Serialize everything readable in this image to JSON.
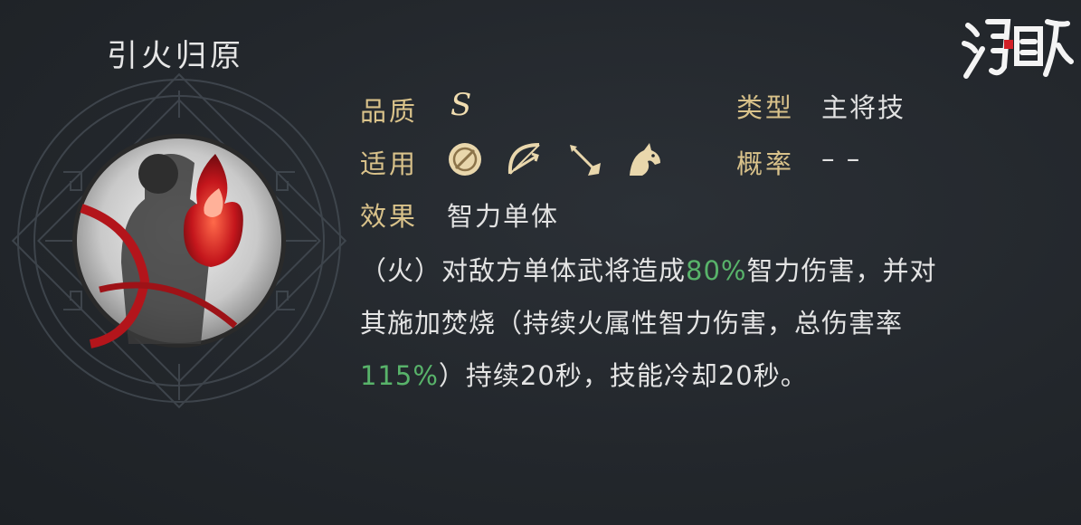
{
  "skill": {
    "name": "引火归原",
    "quality_label": "品质",
    "quality_value": "S",
    "type_label": "类型",
    "type_value": "主将技",
    "apply_label": "适用",
    "apply_icons": [
      "shield-icon",
      "bow-icon",
      "spear-icon",
      "horse-icon"
    ],
    "rate_label": "概率",
    "rate_value": "– –",
    "effect_label": "效果",
    "effect_value": "智力单体",
    "description": {
      "line1_a": "（火）对敌方单体武将造成",
      "line1_hl": "80%",
      "line1_b": "智力伤害，并对",
      "line2": "其施加焚烧（持续火属性智力伤害，总伤害率",
      "line3_hl": "115%",
      "line3_b": "）持续20秒，技能冷却20秒。"
    }
  },
  "logo": {
    "text": "鸿图之下"
  },
  "colors": {
    "label": "#d9c28a",
    "highlight": "#58b36a",
    "text": "#e4e4e4"
  }
}
